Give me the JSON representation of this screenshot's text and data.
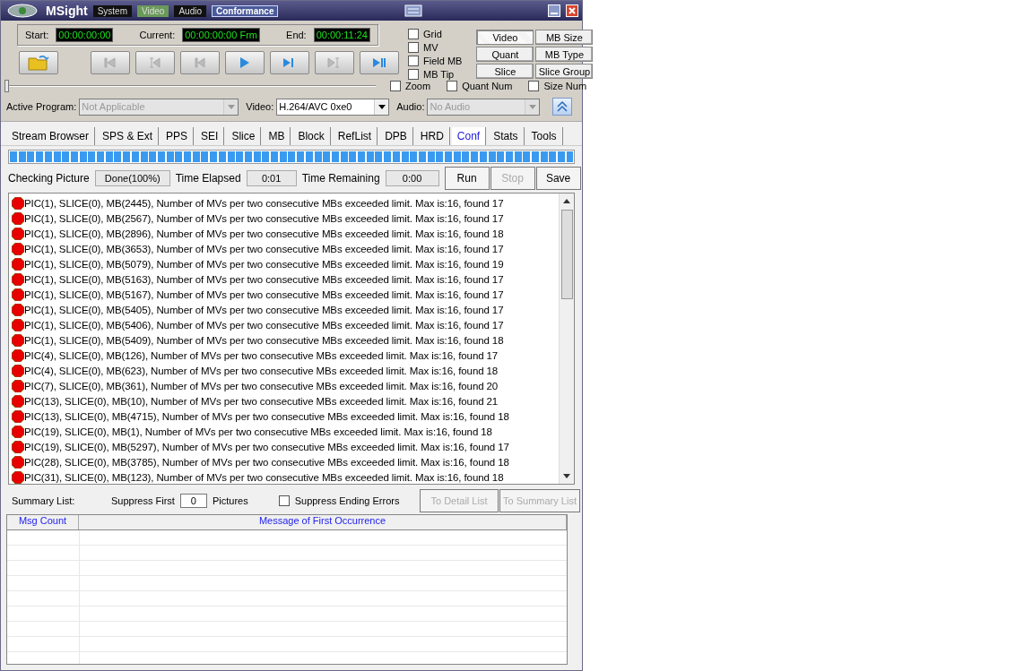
{
  "window": {
    "title": "MSight",
    "modes": [
      {
        "label": "System",
        "selected": false,
        "outlined": false
      },
      {
        "label": "Video",
        "selected": true,
        "outlined": false
      },
      {
        "label": "Audio",
        "selected": false,
        "outlined": false
      },
      {
        "label": "Conformance",
        "selected": false,
        "outlined": true
      }
    ]
  },
  "timecodes": [
    {
      "label": "Start:",
      "value": "00:00:00:00"
    },
    {
      "label": "Current:",
      "value": "00:00:00:00 Frm"
    },
    {
      "label": "End:",
      "value": "00:00:11:24"
    }
  ],
  "transport": [
    {
      "kind": "first",
      "disabled": true
    },
    {
      "kind": "markback",
      "disabled": true
    },
    {
      "kind": "back",
      "disabled": true
    },
    {
      "kind": "play",
      "disabled": false
    },
    {
      "kind": "forward",
      "disabled": false
    },
    {
      "kind": "markforward",
      "disabled": true
    },
    {
      "kind": "playpause",
      "disabled": false
    }
  ],
  "position": {
    "level": 0
  },
  "overlay_checks": [
    {
      "label": "Grid",
      "checked": false
    },
    {
      "label": "MV",
      "checked": false
    },
    {
      "label": "Field MB",
      "checked": false
    },
    {
      "label": "MB Tip",
      "checked": false
    }
  ],
  "overlay_buttons": [
    {
      "label": "Video",
      "selected": true
    },
    {
      "label": "MB Size",
      "selected": false
    },
    {
      "label": "Quant",
      "selected": false
    },
    {
      "label": "MB Type",
      "selected": false
    },
    {
      "label": "Slice",
      "selected": false
    },
    {
      "label": "Slice Group",
      "selected": false
    }
  ],
  "view_checks": [
    {
      "label": "Zoom",
      "checked": false
    },
    {
      "label": "Quant Num",
      "checked": false
    },
    {
      "label": "Size Num",
      "checked": false
    }
  ],
  "selectors": [
    {
      "label": "Active Program:",
      "value": "Not Applicable",
      "disabled": true
    },
    {
      "label": "Video:",
      "value": "H.264/AVC 0xe0",
      "disabled": false
    },
    {
      "label": "Audio:",
      "value": "No Audio",
      "disabled": true
    }
  ],
  "tabs": [
    {
      "label": "Stream Browser",
      "selected": false
    },
    {
      "label": "SPS & Ext",
      "selected": false
    },
    {
      "label": "PPS",
      "selected": false
    },
    {
      "label": "SEI",
      "selected": false
    },
    {
      "label": "Slice",
      "selected": false
    },
    {
      "label": "MB",
      "selected": false
    },
    {
      "label": "Block",
      "selected": false
    },
    {
      "label": "RefList",
      "selected": false
    },
    {
      "label": "DPB",
      "selected": false
    },
    {
      "label": "HRD",
      "selected": false
    },
    {
      "label": "Conf",
      "selected": true
    },
    {
      "label": "Stats",
      "selected": false
    },
    {
      "label": "Tools",
      "selected": false
    }
  ],
  "progress": {
    "level": 1
  },
  "status": [
    {
      "label": "Checking Picture",
      "value": "Done(100%)"
    },
    {
      "label": "Time Elapsed",
      "value": "0:01"
    },
    {
      "label": "Time Remaining",
      "value": "0:00"
    }
  ],
  "actions": [
    {
      "label": "Run",
      "disabled": false
    },
    {
      "label": "Stop",
      "disabled": true
    },
    {
      "label": "Save",
      "disabled": false
    }
  ],
  "messages": [
    "PIC(1), SLICE(0), MB(2445),  Number of MVs per two consecutive MBs exceeded limit. Max is:16, found 17",
    "PIC(1), SLICE(0), MB(2567),  Number of MVs per two consecutive MBs exceeded limit. Max is:16, found 17",
    "PIC(1), SLICE(0), MB(2896),  Number of MVs per two consecutive MBs exceeded limit. Max is:16, found 18",
    "PIC(1), SLICE(0), MB(3653),  Number of MVs per two consecutive MBs exceeded limit. Max is:16, found 17",
    "PIC(1), SLICE(0), MB(5079),  Number of MVs per two consecutive MBs exceeded limit. Max is:16, found 19",
    "PIC(1), SLICE(0), MB(5163),  Number of MVs per two consecutive MBs exceeded limit. Max is:16, found 17",
    "PIC(1), SLICE(0), MB(5167),  Number of MVs per two consecutive MBs exceeded limit. Max is:16, found 17",
    "PIC(1), SLICE(0), MB(5405),  Number of MVs per two consecutive MBs exceeded limit. Max is:16, found 17",
    "PIC(1), SLICE(0), MB(5406),  Number of MVs per two consecutive MBs exceeded limit. Max is:16, found 17",
    "PIC(1), SLICE(0), MB(5409),  Number of MVs per two consecutive MBs exceeded limit. Max is:16, found 18",
    "PIC(4), SLICE(0), MB(126),  Number of MVs per two consecutive MBs exceeded limit. Max is:16, found 17",
    "PIC(4), SLICE(0), MB(623),  Number of MVs per two consecutive MBs exceeded limit. Max is:16, found 18",
    "PIC(7), SLICE(0), MB(361),  Number of MVs per two consecutive MBs exceeded limit. Max is:16, found 20",
    "PIC(13), SLICE(0), MB(10),  Number of MVs per two consecutive MBs exceeded limit. Max is:16, found 21",
    "PIC(13), SLICE(0), MB(4715),  Number of MVs per two consecutive MBs exceeded limit. Max is:16, found 18",
    "PIC(19), SLICE(0), MB(1),  Number of MVs per two consecutive MBs exceeded limit. Max is:16, found 18",
    "PIC(19), SLICE(0), MB(5297),  Number of MVs per two consecutive MBs exceeded limit. Max is:16, found 17",
    "PIC(28), SLICE(0), MB(3785),  Number of MVs per two consecutive MBs exceeded limit. Max is:16, found 18",
    "PIC(31), SLICE(0), MB(123),  Number of MVs per two consecutive MBs exceeded limit. Max is:16, found 18"
  ],
  "summary": {
    "label": "Summary List:",
    "suppress_label": "Suppress First",
    "suppress_value": "0",
    "suppress_unit": "Pictures",
    "ending": {
      "label": "Suppress Ending Errors",
      "checked": false
    },
    "buttons": [
      {
        "label": "To Detail List",
        "disabled": true
      },
      {
        "label": "To Summary List",
        "disabled": true
      }
    ],
    "columns": [
      "Msg Count",
      "Message of First Occurrence"
    ]
  }
}
